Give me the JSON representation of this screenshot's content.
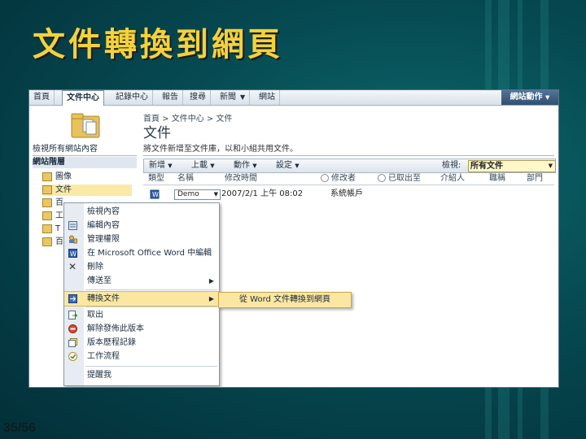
{
  "slide": {
    "title": "文件轉換到網頁",
    "page_number": "35/56"
  },
  "topnav": {
    "tabs": [
      "首頁",
      "文件中心",
      "記錄中心",
      "報告",
      "搜尋",
      "新聞",
      "網站"
    ],
    "active_tab": "文件中心",
    "site_actions": "網站動作"
  },
  "header": {
    "breadcrumb": "首頁 > 文件中心 > 文件",
    "title": "文件"
  },
  "leftnav": {
    "view_all": "檢視所有網站內容",
    "section": "網站階層",
    "items": [
      "圖像",
      "文件",
      "百",
      "工",
      "T",
      "百"
    ]
  },
  "library": {
    "description": "將文件新增至文件庫，以和小組共用文件。",
    "toolbar": {
      "new": "新增",
      "upload": "上載",
      "actions": "動作",
      "settings": "設定",
      "view_label": "檢視:",
      "view_value": "所有文件"
    },
    "columns": [
      "類型",
      "名稱",
      "修改時間",
      "修改者",
      "已取出至",
      "介紹人",
      "職稱",
      "部門"
    ],
    "rows": [
      {
        "name": "Demo",
        "modified": "2007/2/1 上午 08:02",
        "modified_by": "系統帳戶"
      }
    ]
  },
  "context_menu": {
    "items": [
      {
        "label": "檢視內容",
        "icon": "none"
      },
      {
        "label": "編輯內容",
        "icon": "edit-properties-icon"
      },
      {
        "label": "管理權限",
        "icon": "permissions-icon"
      },
      {
        "label": "在 Microsoft Office Word 中編輯",
        "icon": "word-icon"
      },
      {
        "label": "刪除",
        "icon": "delete-icon"
      },
      {
        "label": "傳送至",
        "icon": "none",
        "submenu": true
      },
      {
        "label": "轉換文件",
        "icon": "convert-icon",
        "submenu": true,
        "highlighted": true
      },
      {
        "label": "取出",
        "icon": "checkout-icon"
      },
      {
        "label": "解除發佈此版本",
        "icon": "unpublish-icon"
      },
      {
        "label": "版本歷程記錄",
        "icon": "version-history-icon"
      },
      {
        "label": "工作流程",
        "icon": "workflow-icon"
      },
      {
        "label": "提醒我",
        "icon": "none"
      }
    ],
    "submenu_item": "從 Word 文件轉換到網頁"
  },
  "colors": {
    "title": "#f3d23a",
    "highlight": "#fbe7a1",
    "background": "#064a52"
  }
}
